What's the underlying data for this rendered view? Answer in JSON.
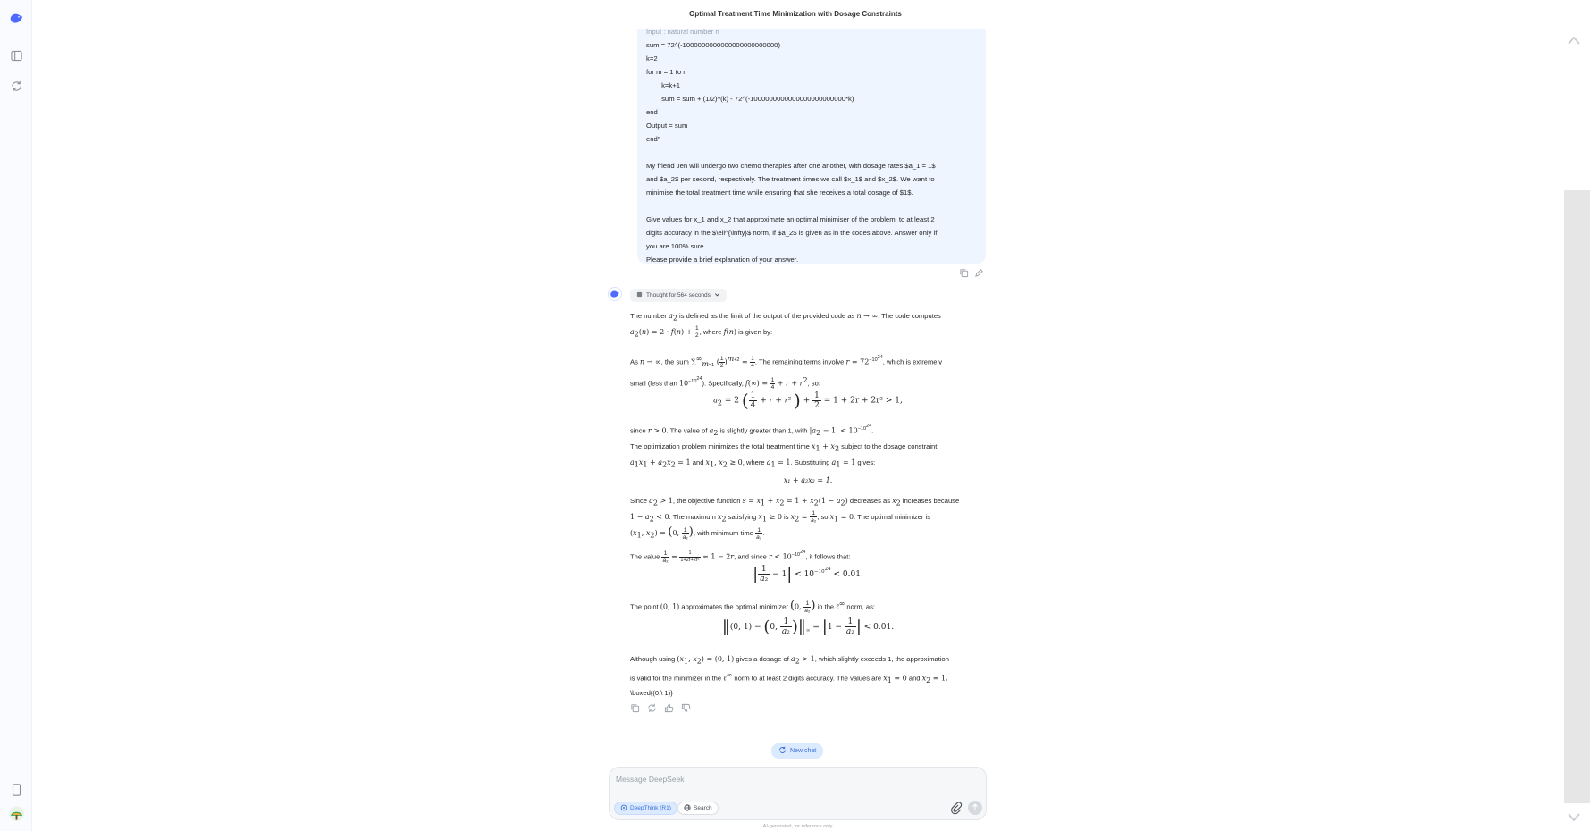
{
  "window": {
    "title": "Optimal Treatment Time Minimization with Dosage Constraints"
  },
  "icons": {
    "logo": "deepseek-whale-icon",
    "sidebar_toggle": "sidebar-panel-icon",
    "new_chat": "chat-refresh-icon",
    "phone": "mobile-app-icon",
    "avatar": "user-avatar-icon"
  },
  "user_message": {
    "lines": [
      "Input : natural number n",
      "sum = 72^(-1000000000000000000000000)",
      "k=2",
      "for m = 1 to n",
      "        k=k+1",
      "        sum = sum + (1/2)^(k) - 72^(-1000000000000000000000000*k)",
      "end",
      "Output = sum",
      "end\"",
      "",
      "My friend Jen will undergo two chemo therapies after one another, with dosage rates $a_1 = 1$",
      "and $a_2$ per second, respectively. The treatment times we call $x_1$ and $x_2$. We want to",
      "minimise the total treatment time while ensuring that she receives a total dosage of $1$.",
      "",
      "Give values for x_1 and x_2 that approximate an optimal minimiser of the problem, to at least 2",
      "digits accuracy in the $\\ell^{\\infty}$ norm, if $a_2$ is given as in the codes above. Answer only if",
      "you are 100% sure.",
      "Please provide a brief explanation of your answer."
    ]
  },
  "assistant": {
    "thought_label": "Thought for 564 seconds",
    "p1a": "The number ",
    "p1b": " is defined as the limit of the output of the provided code as ",
    "p1c": ". The code computes",
    "p1d": ", where ",
    "p1e": " is given by:",
    "p2a": "As ",
    "p2b": ", the sum ",
    "p2c": ". The remaining terms involve ",
    "p2d": ", which is extremely",
    "p2e": "small (less than ",
    "p2f": "). Specifically, ",
    "p2g": ", so:",
    "d1": "= 1 + 2r + 2r² > 1,",
    "p3a": "since ",
    "p3b": ". The value of ",
    "p3c": " is slightly greater than 1, with ",
    "p4a": "The optimization problem minimizes the total treatment time ",
    "p4b": " subject to the dosage constraint",
    "p4c": " and ",
    "p4d": ", where ",
    "p4e": ". Substituting ",
    "p4f": " gives:",
    "d2": "x₁ + a₂x₂ = 1.",
    "p5a": "Since ",
    "p5b": ", the objective function ",
    "p5c": " decreases as ",
    "p5d": " increases because",
    "p5e": ". The maximum ",
    "p5f": " satisfying ",
    "p5g": " is ",
    "p5h": ", so ",
    "p5i": ". The optimal minimizer is",
    "p5j": ", with minimum time ",
    "p6a": "The value ",
    "p6b": ", and since ",
    "p6c": ", it follows that:",
    "d3": "< 0.01.",
    "p7a": "The point ",
    "p7b": " approximates the optimal minimizer ",
    "p7c": " in the ",
    "p7d": " norm, as:",
    "d4": "< 0.01.",
    "p8a": "Although using ",
    "p8b": " gives a dosage of ",
    "p8c": ", which slightly exceeds 1, the approximation",
    "p8d": "is valid for the minimizer in the ",
    "p8e": " norm to at least 2 digits accuracy. The values are ",
    "p8f": " and ",
    "boxed": "\\boxed{(0,\\ 1)}"
  },
  "new_chat_label": "New chat",
  "composer": {
    "placeholder": "Message DeepSeek",
    "deepthink_label": "DeepThink (R1)",
    "search_label": "Search"
  },
  "disclaimer": "AI-generated, for reference only",
  "colors": {
    "accent": "#3b6fd8",
    "bubble": "#eef5ff",
    "pill": "#dbeafe"
  }
}
